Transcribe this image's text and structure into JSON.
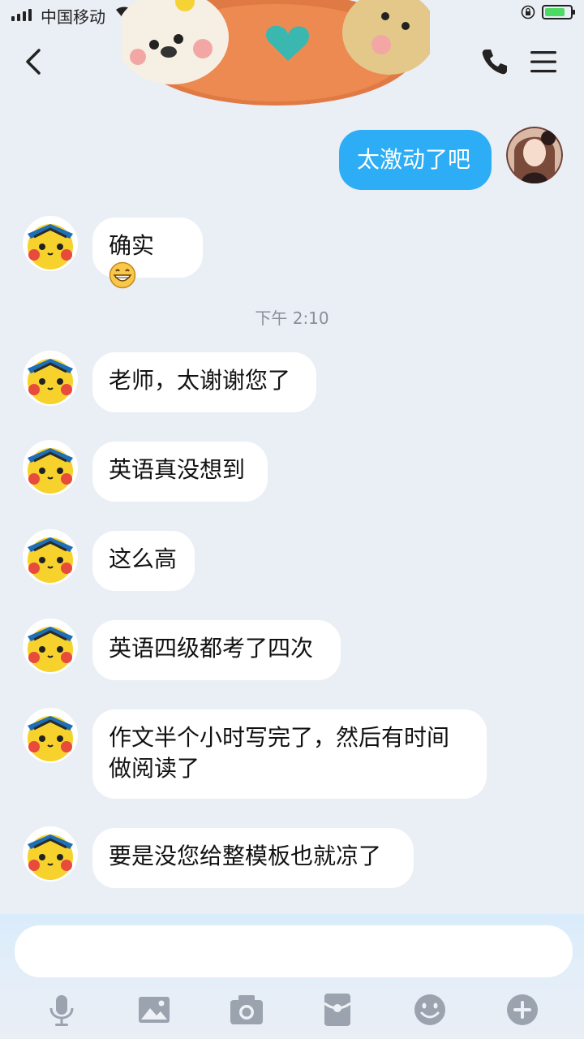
{
  "status_bar": {
    "carrier": "中国移动",
    "battery_level": 0.7
  },
  "header": {
    "back_icon": "back-chevron-icon",
    "phone_icon": "phone-icon",
    "menu_icon": "menu-icon"
  },
  "messages": [
    {
      "from": "me",
      "text": "太激动了吧"
    },
    {
      "from": "other",
      "text": "确实"
    },
    {
      "type": "time",
      "text": "下午 2:10"
    },
    {
      "from": "other",
      "text": "老师，太谢谢您了"
    },
    {
      "from": "other",
      "text": "英语真没想到"
    },
    {
      "from": "other",
      "text": "这么高"
    },
    {
      "from": "other",
      "text": "英语四级都考了四次"
    },
    {
      "from": "other",
      "text_line1": "作文半个小时写完了，然后有时间",
      "text_line2": "做阅读了"
    },
    {
      "from": "other",
      "text": "要是没您给整模板也就凉了"
    }
  ],
  "input": {
    "placeholder": ""
  },
  "toolbar": [
    "mic-icon",
    "image-icon",
    "camera-icon",
    "red-packet-icon",
    "emoji-icon",
    "plus-icon"
  ],
  "colors": {
    "my_bubble": "#2dadf5",
    "background": "#eaeef5"
  }
}
